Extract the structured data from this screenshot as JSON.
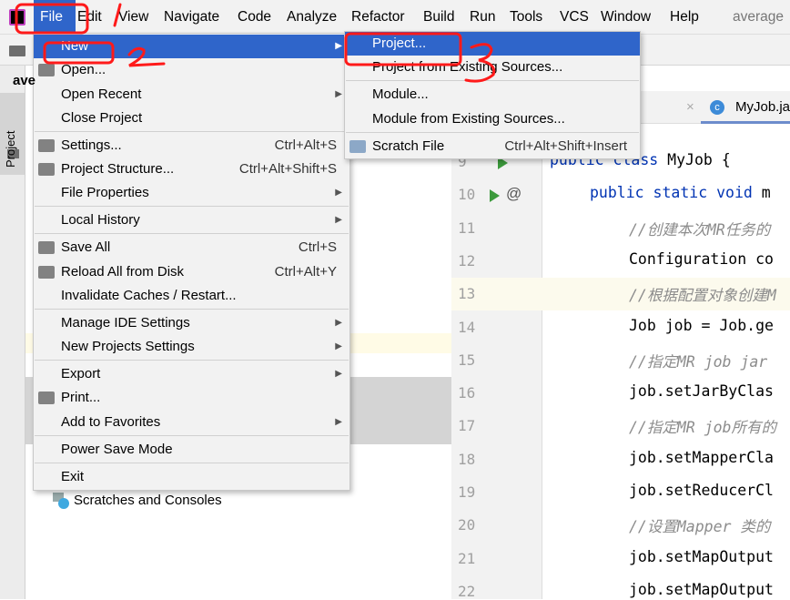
{
  "menubar": {
    "items": [
      "File",
      "Edit",
      "View",
      "Navigate",
      "Code",
      "Analyze",
      "Refactor",
      "Build",
      "Run",
      "Tools",
      "VCS",
      "Window",
      "Help"
    ],
    "project_name": "average"
  },
  "left_strip": {
    "project_tab": "Project"
  },
  "project_panel": {
    "root_label": "ave",
    "scratches": "Scratches and Consoles"
  },
  "editor": {
    "tab": "MyJob.ja",
    "lines": [
      {
        "n": "9",
        "text": "public class MyJob {",
        "type": "kw"
      },
      {
        "n": "10",
        "text": "public static void m",
        "type": "kw"
      },
      {
        "n": "11",
        "text": "//创建本次MR任务的",
        "type": "cm"
      },
      {
        "n": "12",
        "text": "Configuration co",
        "type": "code"
      },
      {
        "n": "13",
        "text": "//根据配置对象创建M",
        "type": "cm"
      },
      {
        "n": "14",
        "text": "Job job = Job.ge",
        "type": "code"
      },
      {
        "n": "15",
        "text": "//指定MR job jar",
        "type": "cm"
      },
      {
        "n": "16",
        "text": "job.setJarByClas",
        "type": "code"
      },
      {
        "n": "17",
        "text": "//指定MR job所有的",
        "type": "cm"
      },
      {
        "n": "18",
        "text": "job.setMapperCla",
        "type": "code"
      },
      {
        "n": "19",
        "text": "job.setReducerCl",
        "type": "code"
      },
      {
        "n": "20",
        "text": "//设置Mapper 类的",
        "type": "cm"
      },
      {
        "n": "21",
        "text": "job.setMapOutput",
        "type": "code"
      },
      {
        "n": "22",
        "text": "job.setMapOutput",
        "type": "code"
      }
    ]
  },
  "file_menu": {
    "items": [
      {
        "label": "New",
        "arrow": true,
        "highlighted": true
      },
      {
        "label": "Open...",
        "icon": "folder-icon"
      },
      {
        "label": "Open Recent",
        "arrow": true
      },
      {
        "label": "Close Project"
      },
      {
        "label": "Settings...",
        "shortcut": "Ctrl+Alt+S",
        "icon": "wrench-icon"
      },
      {
        "label": "Project Structure...",
        "shortcut": "Ctrl+Alt+Shift+S",
        "icon": "project-structure-icon"
      },
      {
        "label": "File Properties",
        "arrow": true
      },
      {
        "label": "Local History",
        "arrow": true
      },
      {
        "label": "Save All",
        "shortcut": "Ctrl+S",
        "icon": "save-icon"
      },
      {
        "label": "Reload All from Disk",
        "shortcut": "Ctrl+Alt+Y",
        "icon": "reload-icon"
      },
      {
        "label": "Invalidate Caches / Restart..."
      },
      {
        "label": "Manage IDE Settings",
        "arrow": true
      },
      {
        "label": "New Projects Settings",
        "arrow": true
      },
      {
        "label": "Export",
        "arrow": true
      },
      {
        "label": "Print...",
        "icon": "printer-icon"
      },
      {
        "label": "Add to Favorites",
        "arrow": true
      },
      {
        "label": "Power Save Mode"
      },
      {
        "label": "Exit"
      }
    ]
  },
  "new_submenu": {
    "items": [
      {
        "label": "Project...",
        "highlighted": true
      },
      {
        "label": "Project from Existing Sources..."
      },
      {
        "label": "Module..."
      },
      {
        "label": "Module from Existing Sources..."
      },
      {
        "label": "Scratch File",
        "shortcut": "Ctrl+Alt+Shift+Insert",
        "icon": "scratch-file-icon"
      }
    ]
  },
  "colors": {
    "highlight": "#2f65ca",
    "annotation": "#ff1a1a",
    "keyword": "#0033b3",
    "comment": "#8c8c8c"
  }
}
